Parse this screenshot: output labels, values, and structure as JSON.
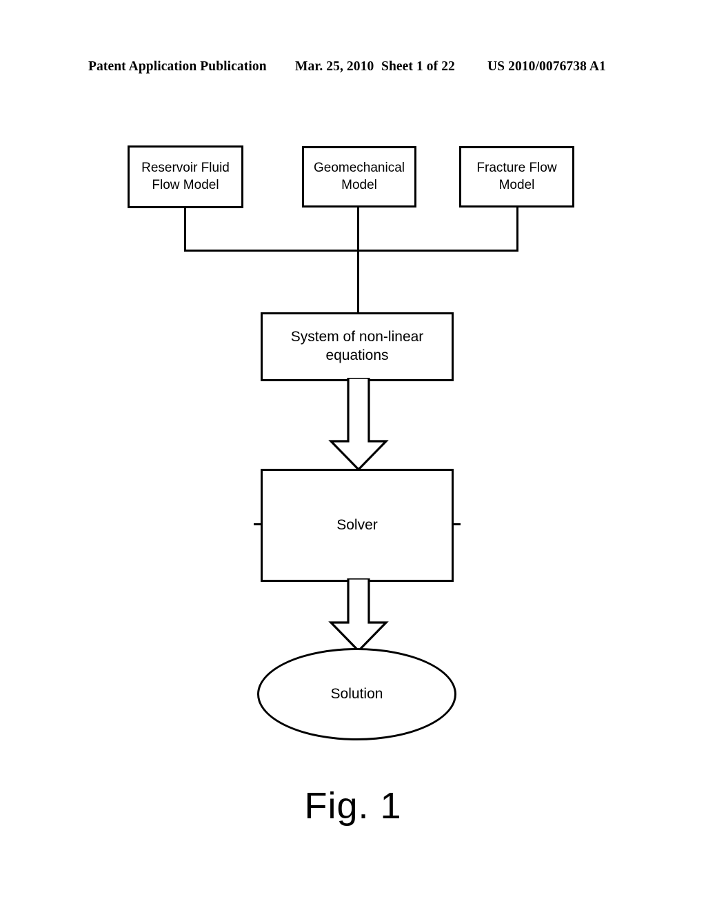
{
  "document": {
    "header": {
      "publication_label": "Patent Application Publication",
      "date": "Mar. 25, 2010",
      "sheet": "Sheet 1 of 22",
      "publication_number": "US 2010/0076738 A1"
    },
    "figure": {
      "caption": "Fig. 1",
      "nodes": {
        "reservoir_model": "Reservoir Fluid\nFlow Model",
        "reservoir_model_line1": "Reservoir Fluid",
        "reservoir_model_line2": "Flow Model",
        "geomechanical_model_line1": "Geomechanical",
        "geomechanical_model_line2": "Model",
        "fracture_model_line1": "Fracture Flow",
        "fracture_model_line2": "Model",
        "system_equations_line1": "System of non-linear",
        "system_equations_line2": "equations",
        "solver": "Solver",
        "solution": "Solution"
      }
    }
  },
  "colors": {
    "ink": "#000000",
    "paper": "#ffffff"
  }
}
